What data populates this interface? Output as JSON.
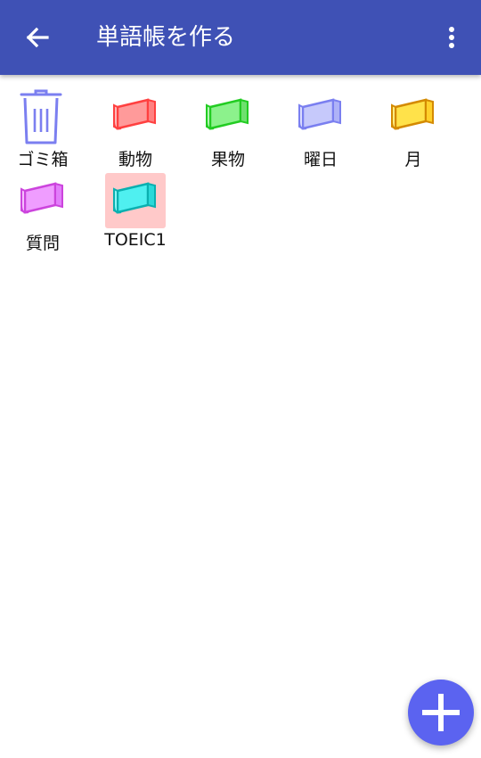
{
  "appbar": {
    "title": "単語帳を作る",
    "back_icon": "arrow-left-icon",
    "menu_icon": "more-vertical-icon",
    "color": "#3f51b5"
  },
  "items": [
    {
      "label": "ゴミ箱",
      "icon": "trash-icon",
      "color": "#7b7ff0"
    },
    {
      "label": "動物",
      "icon": "book-icon",
      "color": "#ff4040",
      "fill": "#ff9a9a"
    },
    {
      "label": "果物",
      "icon": "book-icon",
      "color": "#22cc22",
      "fill": "#8cf28c"
    },
    {
      "label": "曜日",
      "icon": "book-icon",
      "color": "#7a7ff0",
      "fill": "#c6c9fb"
    },
    {
      "label": "月",
      "icon": "book-icon",
      "color": "#d48a00",
      "fill": "#ffe24a"
    },
    {
      "label": "質問",
      "icon": "book-icon",
      "color": "#cc44dd",
      "fill": "#ef9dff"
    },
    {
      "label": "TOEIC1",
      "icon": "book-icon",
      "color": "#0ab0b0",
      "fill": "#4ff0f0",
      "selected": true
    }
  ],
  "fab": {
    "icon": "plus-icon",
    "color": "#5b63f0"
  }
}
